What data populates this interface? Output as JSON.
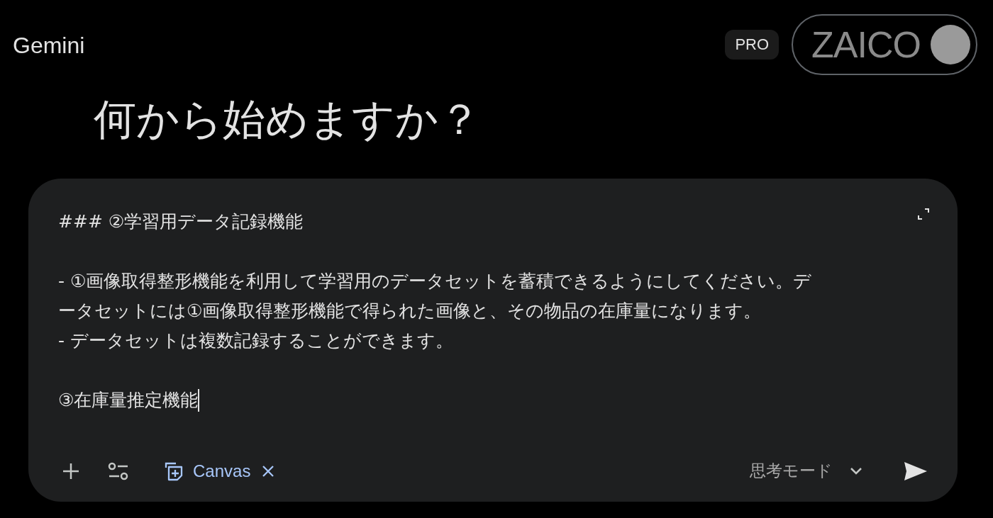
{
  "app": {
    "title": "Gemini"
  },
  "header": {
    "plan_badge": "PRO",
    "account": {
      "logo_text": "ZAICO"
    }
  },
  "greeting": "何から始めますか？",
  "prompt": {
    "paragraphs": [
      [
        "### ②学習用データ記録機能"
      ],
      [
        "- ①画像取得整形機能を利用して学習用のデータセットを蓄積できるようにしてください。デ",
        "ータセットには①画像取得整形機能で得られた画像と、その物品の在庫量になります。",
        "- データセットは複数記録することができます。"
      ],
      [
        "③在庫量推定機能"
      ]
    ]
  },
  "toolbar": {
    "tool_chip": {
      "label": "Canvas",
      "selected": true
    },
    "mode": {
      "label": "思考モード"
    }
  }
}
